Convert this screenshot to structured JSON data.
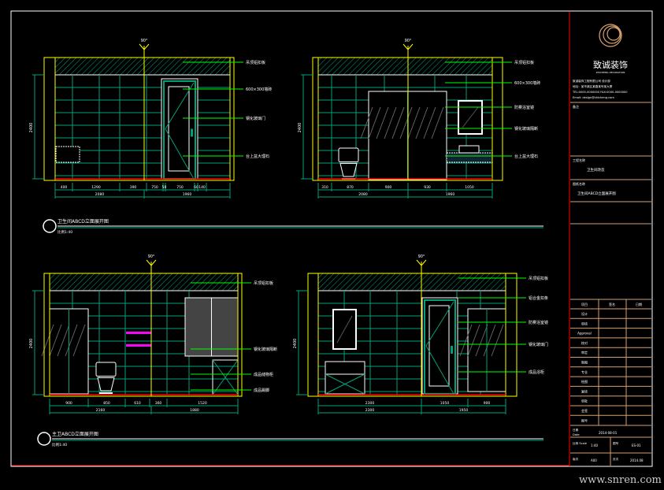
{
  "colors": {
    "background": "#000000",
    "frame": "#ffffff",
    "wall_outline": "#ffff00",
    "tile_grid": "#00a07a",
    "leader": "#00ff00",
    "floor": "#ff0000",
    "title_block": "#d4a070",
    "accent_green": "#00a07a",
    "shelf": "#ff00ff"
  },
  "elevations": [
    {
      "angle_label": "90°",
      "height_label": "2400",
      "dims_row1": [
        "400",
        "1290",
        "390",
        "750",
        "50",
        "750",
        "60",
        "140"
      ],
      "dims_row2": [
        "2080",
        "1960"
      ],
      "callouts": [
        "吊顶铝扣板",
        "600×300墙砖",
        "钢化玻璃门",
        "台上盆大理石"
      ]
    },
    {
      "angle_label": "90°",
      "height_label": "2400",
      "dims_row1": [
        "310",
        "870",
        "900",
        "930",
        "1050"
      ],
      "dims_row2": [
        "2080",
        "1960"
      ],
      "callouts": [
        "吊顶铝扣板",
        "600×300墙砖",
        "防雾浴室镜",
        "钢化玻璃隔断",
        "台上盆大理石"
      ]
    },
    {
      "angle_label": "90°",
      "height_label": "2400",
      "dims_row1": [
        "900",
        "850",
        "610",
        "360",
        "1520"
      ],
      "dims_row2": [
        "2160",
        "1880"
      ],
      "callouts": [
        "吊顶铝扣板",
        "钢化玻璃隔断",
        "成品储物柜",
        "成品踢脚"
      ]
    },
    {
      "angle_label": "90°",
      "height_label": "2400",
      "dims_row1": [
        "2300",
        "1050",
        "900"
      ],
      "dims_row2": [
        "2300",
        "1950"
      ],
      "callouts": [
        "吊顶铝扣板",
        "铝合金扣条",
        "防雾浴室镜",
        "钢化玻璃门",
        "成品浴柜"
      ]
    }
  ],
  "drawing_titles": [
    {
      "title": "卫生间ABCD立面展开图",
      "scale": "比例1:40"
    },
    {
      "title": "主卫ABCD立面展开图",
      "scale": "比例1:40"
    }
  ],
  "title_block": {
    "company": "致诚装饰",
    "company_en": "ZHICHENG DECORATION",
    "info_lines": [
      "致诚装饰工程有限公司 设计部",
      "地址：某市某区某路某号某大厦",
      "TEL:0000-0000000  FAX:0000-0000000",
      "Email: design@zhicheng.com"
    ],
    "section_label": "备注",
    "project_label": "工程名称",
    "project_name": "卫生间改造",
    "drawing_label": "图纸名称",
    "drawing_name": "卫生间ABCD立面展开图",
    "table_headers": [
      "项目",
      "签名",
      "日期"
    ],
    "table_rows": [
      "设计",
      "审核",
      "Approval",
      "校对",
      "审定",
      "制图",
      "专业",
      "绘图",
      "复核",
      "审批",
      "会签",
      "图号"
    ],
    "bottom": {
      "date_label": "日期\nDate",
      "date_value": "2014-08-01",
      "scale_label": "比例 Scale",
      "scale_value": "1:40",
      "drawing_no_label": "图号",
      "drawing_no_value": "ES-01",
      "sheet_label": "版次",
      "sheet_value": "A00",
      "ver_label": "页次",
      "ver_value": "2014.08"
    }
  },
  "watermark": "www.snren.com"
}
